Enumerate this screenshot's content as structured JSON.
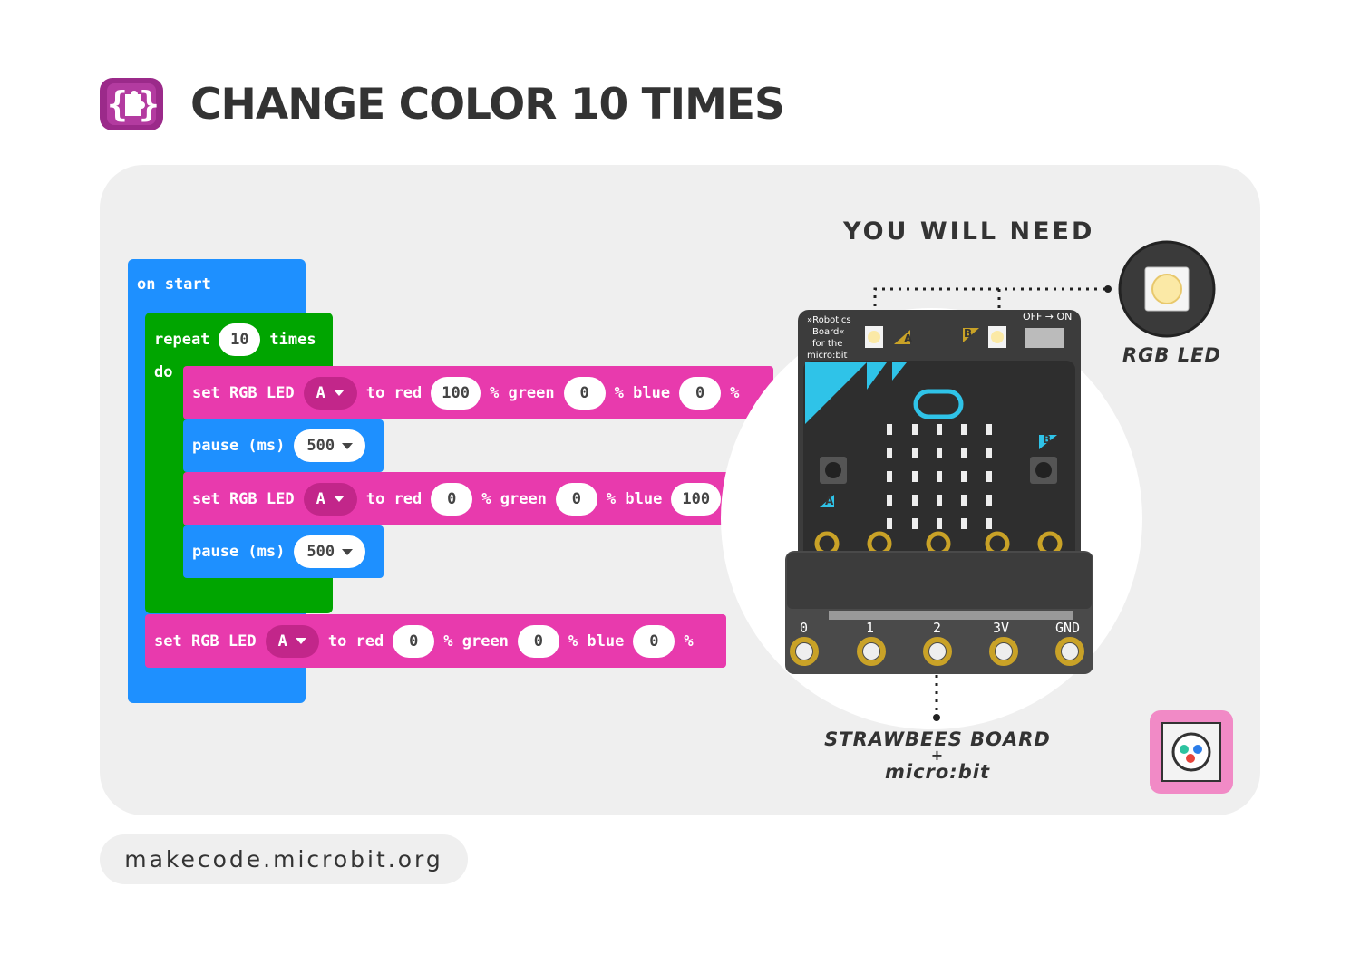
{
  "header": {
    "title": "CHANGE COLOR 10 TIMES"
  },
  "code": {
    "on_start": "on start",
    "repeat": {
      "label": "repeat",
      "count": "10",
      "suffix": "times",
      "do": "do"
    },
    "blocks": [
      {
        "kind": "set_led",
        "prefix": "set RGB LED",
        "led": "A",
        "to_red": "to red",
        "red": "100",
        "green_label": "% green",
        "green": "0",
        "blue_label": "% blue",
        "blue": "0",
        "pct": "%"
      },
      {
        "kind": "pause",
        "label": "pause (ms)",
        "value": "500"
      },
      {
        "kind": "set_led",
        "prefix": "set RGB LED",
        "led": "A",
        "to_red": "to red",
        "red": "0",
        "green_label": "% green",
        "green": "0",
        "blue_label": "% blue",
        "blue": "100",
        "pct": "%"
      },
      {
        "kind": "pause",
        "label": "pause (ms)",
        "value": "500"
      }
    ],
    "final": {
      "prefix": "set RGB LED",
      "led": "A",
      "to_red": "to red",
      "red": "0",
      "green_label": "% green",
      "green": "0",
      "blue_label": "% blue",
      "blue": "0",
      "pct": "%"
    }
  },
  "need": {
    "title": "YOU WILL NEED",
    "rgb_led": "RGB LED",
    "board_line1": "STRAWBEES BOARD",
    "board_plus": "+",
    "board_line2": "micro:bit"
  },
  "board": {
    "text_lines": [
      "»Robotics",
      "Board«",
      "for the",
      "micro:bit"
    ],
    "switch": "OFF → ON",
    "pins": [
      "0",
      "1",
      "2",
      "3V",
      "GND"
    ],
    "btn_a": "A",
    "btn_b": "B"
  },
  "footer": {
    "url": "makecode.microbit.org"
  },
  "colors": {
    "blue": "#1e90ff",
    "green": "#00a500",
    "pink": "#e83aad",
    "purple": "#9b2a8a",
    "pink_badge": "#f18ac6"
  }
}
